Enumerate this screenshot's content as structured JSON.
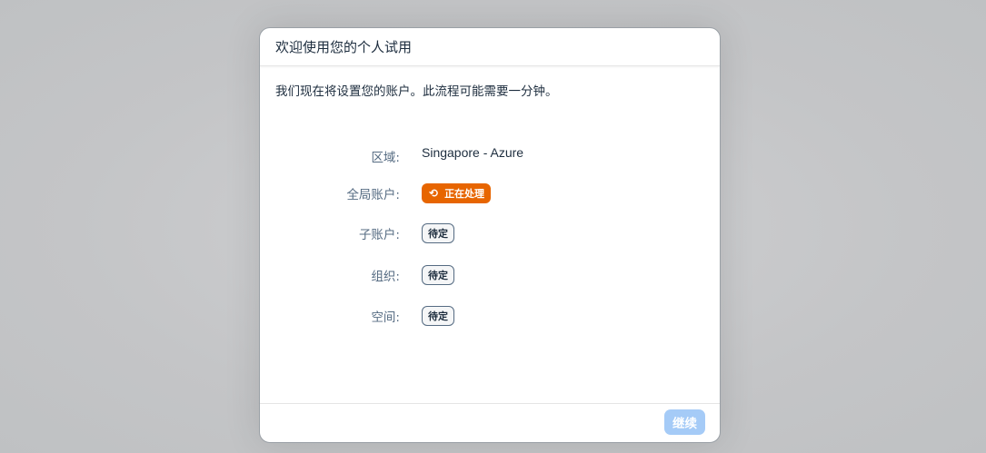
{
  "dialog": {
    "title": "欢迎使用您的个人试用",
    "intro": "我们现在将设置您的账户。此流程可能需要一分钟。",
    "rows": [
      {
        "label": "区域:",
        "value": "Singapore - Azure"
      },
      {
        "label": "全局账户:",
        "status": "正在处理",
        "icon": "sync-icon",
        "status_color": "#e76500"
      },
      {
        "label": "子账户:",
        "status": "待定"
      },
      {
        "label": "组织:",
        "status": "待定"
      },
      {
        "label": "空间:",
        "status": "待定"
      }
    ],
    "continue_label": "继续"
  },
  "colors": {
    "accent_processing": "#e76500",
    "button_disabled": "#a5cbf7",
    "label": "#556b82",
    "text": "#1d2d3e"
  }
}
